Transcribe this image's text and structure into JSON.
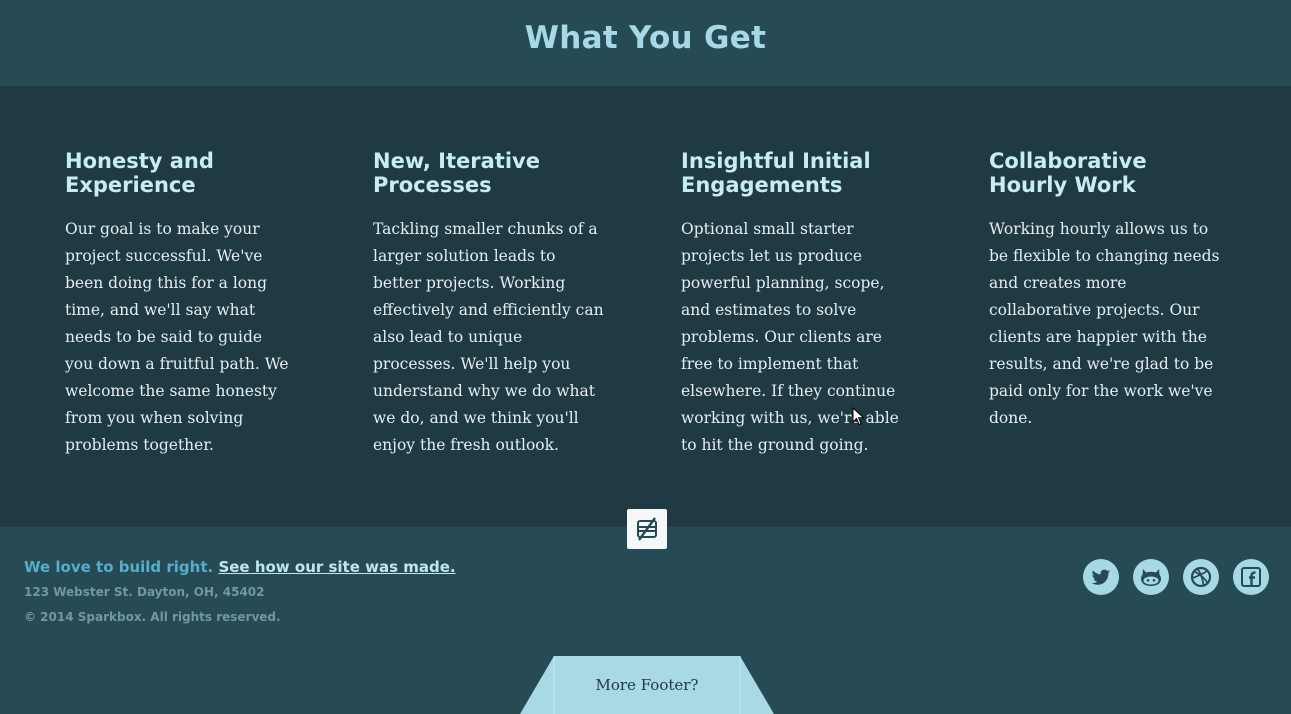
{
  "header": {
    "title": "What You Get"
  },
  "features": [
    {
      "title": "Honesty and Experience",
      "body": "Our goal is to make your project successful. We've been doing this for a long time, and we'll say what needs to be said to guide you down a fruitful path. We welcome the same honesty from you when solving problems together."
    },
    {
      "title": "New, Iterative Processes",
      "body": "Tackling smaller chunks of a larger solution leads to better projects. Working effectively and efficiently can also lead to unique processes. We'll help you understand why we do what we do, and we think you'll enjoy the fresh outlook."
    },
    {
      "title": "Insightful Initial Engagements",
      "body": "Optional small starter projects let us produce powerful planning, scope, and estimates to solve problems. Our clients are free to implement that elsewhere. If they continue working with us, we're able to hit the ground going."
    },
    {
      "title": "Collaborative Hourly Work",
      "body": "Working hourly allows us to be flexible to changing needs and creates more collaborative projects. Our clients are happier with the results, and we're glad to be paid only for the work we've done."
    }
  ],
  "footer": {
    "tagline": "We love to build right.",
    "tagline_link": "See how our site was made.",
    "address": "123 Webster St. Dayton, OH, 45402",
    "copyright": "© 2014 Sparkbox. All rights reserved.",
    "more_footer": "More Footer?",
    "socials": [
      "twitter-icon",
      "github-icon",
      "dribbble-icon",
      "facebook-icon"
    ]
  },
  "colors": {
    "header_bg": "#264b55",
    "features_bg": "#1f3a43",
    "accent": "#a6d9e6",
    "tagline": "#56aecb"
  }
}
